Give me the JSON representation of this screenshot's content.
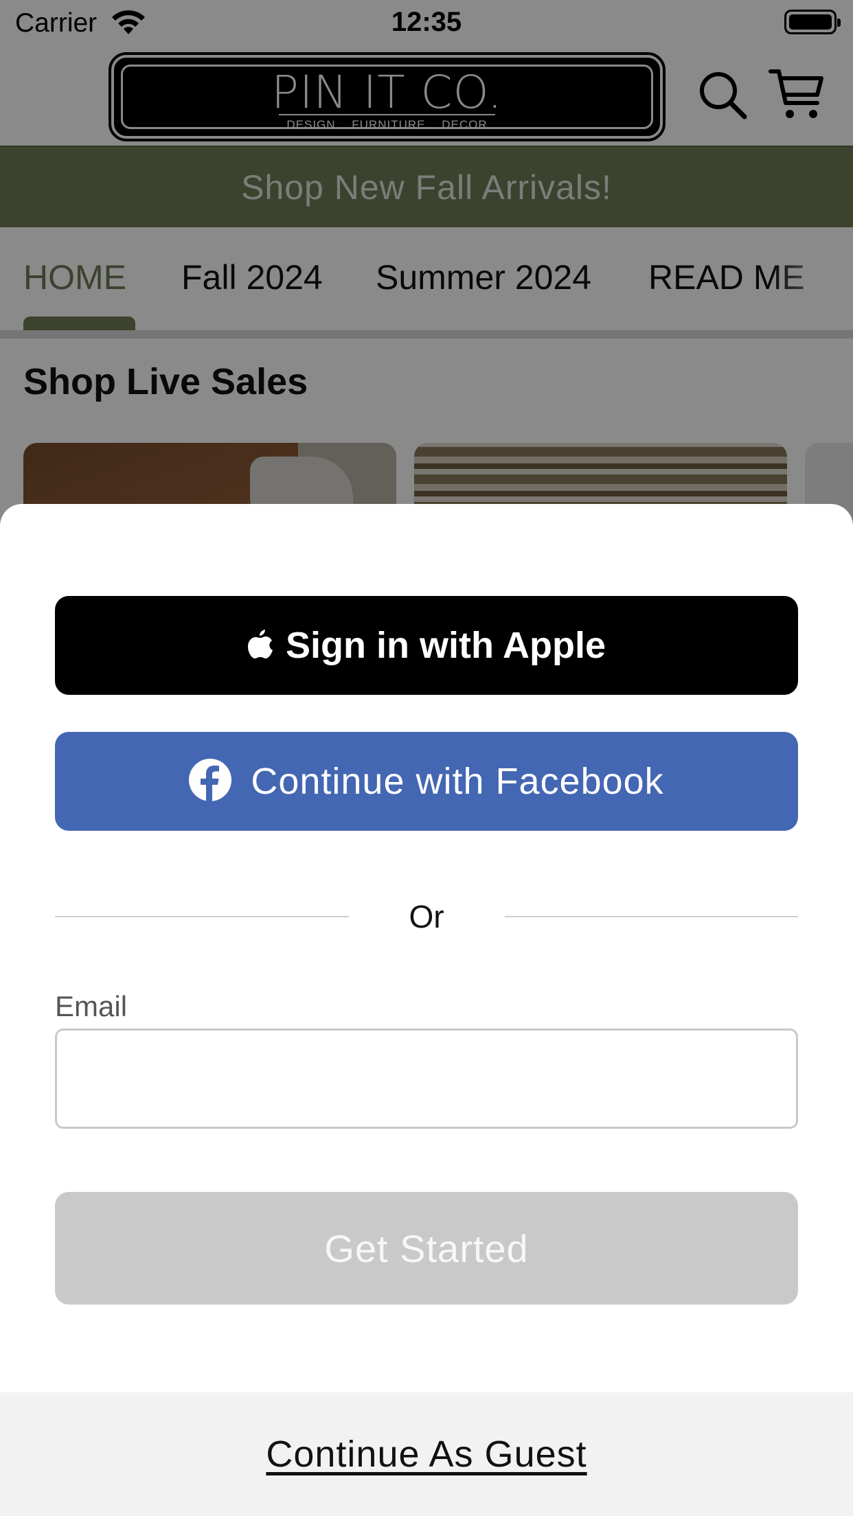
{
  "status_bar": {
    "carrier": "Carrier",
    "time": "12:35",
    "wifi_icon": "wifi-icon",
    "battery_icon": "battery-icon"
  },
  "header": {
    "logo": {
      "title": "PIN IT CO.",
      "tagline": "DESIGN FURNITURE DECOR"
    },
    "search_icon": "search-icon",
    "cart_icon": "cart-icon"
  },
  "promo_banner": {
    "text": "Shop New Fall Arrivals!",
    "color": "#6d7a55"
  },
  "nav": {
    "tabs": [
      {
        "label": "HOME",
        "active": true
      },
      {
        "label": "Fall 2024",
        "active": false
      },
      {
        "label": "Summer 2024",
        "active": false
      },
      {
        "label": "READ ME",
        "active": false
      }
    ]
  },
  "main": {
    "section_title": "Shop Live Sales"
  },
  "sheet": {
    "apple_button": {
      "label": "Sign in with Apple",
      "icon": "apple-icon"
    },
    "facebook_button": {
      "label": "Continue with Facebook",
      "icon": "facebook-icon",
      "color": "#4467b3"
    },
    "divider_text": "Or",
    "email": {
      "label": "Email",
      "value": "",
      "placeholder": ""
    },
    "get_started_button": {
      "label": "Get Started",
      "enabled": false
    },
    "guest_link": "Continue As Guest"
  }
}
